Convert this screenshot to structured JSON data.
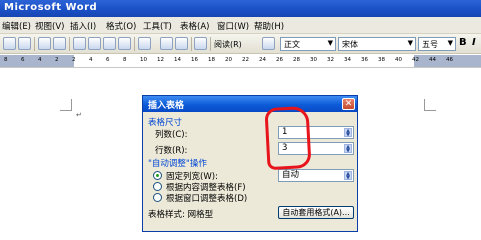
{
  "window": {
    "title": "Microsoft Word"
  },
  "menu": [
    "编辑(E)",
    "视图(V)",
    "插入(I)",
    "格式(O)",
    "工具(T)",
    "表格(A)",
    "窗口(W)",
    "帮助(H)"
  ],
  "toolbar": {
    "reading_label": "阅读(R)",
    "style_value": "正文",
    "font_value": "宋体",
    "size_value": "五号",
    "bold_label": "B",
    "italic_label": "I"
  },
  "ruler": {
    "ticks": [
      "8",
      "6",
      "4",
      "2",
      "2",
      "4",
      "6",
      "8",
      "10",
      "12",
      "14",
      "16",
      "18",
      "20",
      "22",
      "24",
      "26",
      "28",
      "30",
      "32",
      "34",
      "36",
      "38",
      "40",
      "42",
      "44",
      "46"
    ]
  },
  "document": {
    "paragraph_mark": "↵"
  },
  "dialog": {
    "title": "插入表格",
    "size_group": "表格尺寸",
    "columns_label": "列数(C):",
    "columns_value": "1",
    "rows_label": "行数(R):",
    "rows_value": "3",
    "autofit_group": "\"自动调整\"操作",
    "fixed_width_label": "固定列宽(W):",
    "fixed_width_value": "自动",
    "fit_content_label": "根据内容调整表格(F)",
    "fit_window_label": "根据窗口调整表格(D)",
    "style_label": "表格样式: 网格型",
    "autoformat_button": "自动套用格式(A)...",
    "close_symbol": "✕"
  },
  "colors": {
    "annotation": "#e8141c",
    "titlebar": "#1a4fc4"
  }
}
